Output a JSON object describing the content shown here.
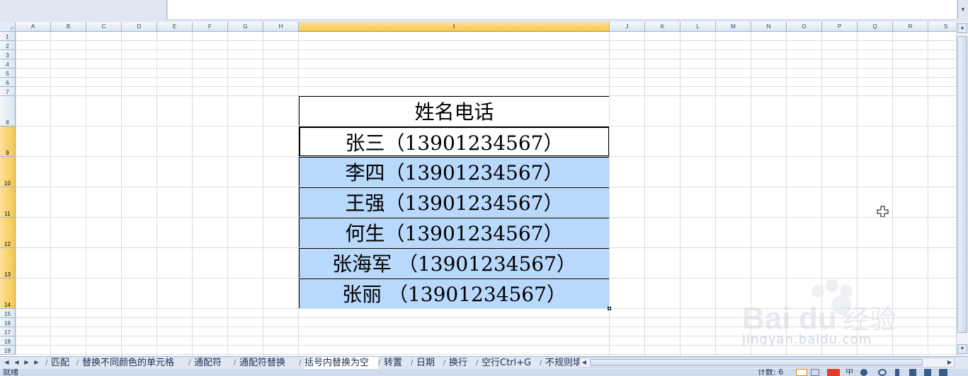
{
  "columns": [
    "A",
    "B",
    "C",
    "D",
    "E",
    "F",
    "G",
    "H",
    "I",
    "J",
    "K",
    "L",
    "M",
    "N",
    "O",
    "P",
    "Q",
    "R",
    "S"
  ],
  "selected_column": "I",
  "rows": [
    "1",
    "2",
    "3",
    "4",
    "5",
    "6",
    "7",
    "8",
    "9",
    "10",
    "11",
    "12",
    "13",
    "14",
    "15",
    "16",
    "17",
    "18",
    "19"
  ],
  "selected_rows": [
    "9",
    "10",
    "11",
    "12",
    "13",
    "14"
  ],
  "table": {
    "header": "姓名电话",
    "cells": [
      "张三（13901234567）",
      "李四（13901234567）",
      "王强（13901234567）",
      "何生（13901234567）",
      "张海军  （13901234567）",
      "张丽  （13901234567）"
    ]
  },
  "sheet_tabs": [
    "匹配",
    "替换不同颜色的单元格",
    "通配符",
    "通配符替换",
    "括号内替换为空",
    "转置",
    "日期",
    "换行",
    "空行Ctrl+G",
    "不规则填充"
  ],
  "active_tab": "括号内替换为空",
  "status": {
    "ready": "就绪",
    "count": "计数: 6"
  },
  "watermark": {
    "logo_text": "Baidu经验",
    "url_text": "jingyan.baidu.com"
  },
  "colors": {
    "selection_fill": "#b8d9fc",
    "header_selected": "#f5c64c"
  }
}
